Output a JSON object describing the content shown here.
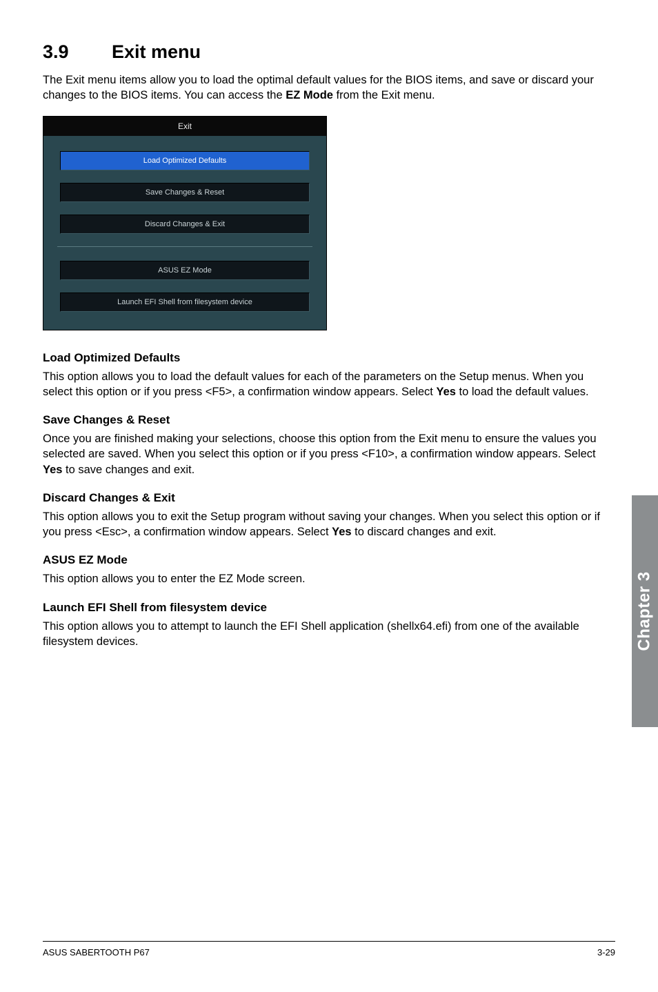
{
  "heading": {
    "num": "3.9",
    "title": "Exit menu"
  },
  "intro_parts": {
    "a": "The Exit menu items allow you to load the optimal default values for the BIOS items, and save or discard your changes to the BIOS items. You can access the ",
    "b": "EZ Mode",
    "c": " from the Exit menu."
  },
  "bios": {
    "tab": "Exit",
    "buttons": {
      "load": "Load Optimized Defaults",
      "save": "Save Changes & Reset",
      "discard": "Discard Changes & Exit",
      "ezmode": "ASUS EZ Mode",
      "efi": "Launch EFI Shell from filesystem device"
    }
  },
  "sections": {
    "load": {
      "h": "Load Optimized Defaults",
      "p_a": "This option allows you to load the default values for each of the parameters on the Setup menus. When you select this option or if you press <F5>, a confirmation window appears. Select ",
      "p_b": "Yes",
      "p_c": " to load the default values."
    },
    "save": {
      "h": "Save Changes & Reset",
      "p_a": "Once you are finished making your selections, choose this option from the Exit menu to ensure the values you selected are saved. When you select this option or if you press <F10>, a confirmation window appears. Select ",
      "p_b": "Yes",
      "p_c": " to save changes and exit."
    },
    "discard": {
      "h": "Discard Changes & Exit",
      "p_a": "This option allows you to exit the Setup program without saving your changes. When you select this option or if you press <Esc>, a confirmation window appears. Select ",
      "p_b": "Yes",
      "p_c": " to discard changes and exit."
    },
    "ezmode": {
      "h": "ASUS EZ Mode",
      "p": "This option allows you to enter the EZ Mode screen."
    },
    "efi": {
      "h": "Launch EFI Shell from filesystem device",
      "p": "This option allows you to attempt to launch the EFI Shell application (shellx64.efi) from one of the available filesystem devices."
    }
  },
  "side_tab": "Chapter 3",
  "footer": {
    "left": "ASUS SABERTOOTH P67",
    "right": "3-29"
  }
}
